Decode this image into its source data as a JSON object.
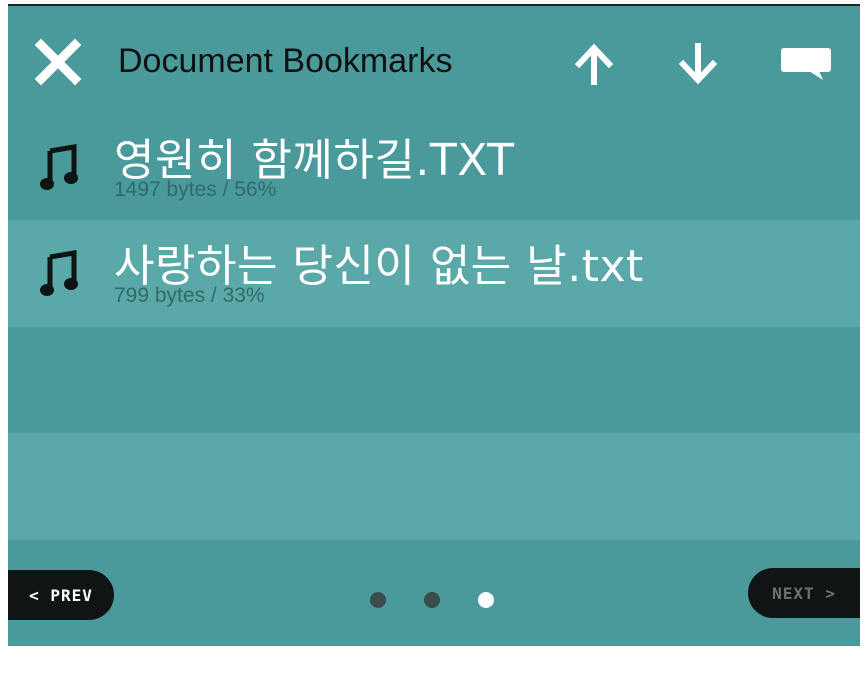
{
  "header": {
    "title": "Document Bookmarks",
    "icons": [
      "close-icon",
      "arrow-up-icon",
      "arrow-down-icon",
      "speech-bubble-icon"
    ]
  },
  "bookmarks": [
    {
      "icon": "music-note-icon",
      "name": "영원히 함께하길.TXT",
      "meta": "1497 bytes / 56%"
    },
    {
      "icon": "music-note-icon",
      "name": "사랑하는 당신이 없는 날.txt",
      "meta": "799 bytes / 33%"
    }
  ],
  "footer": {
    "prev_label": "< PREV",
    "next_label": "NEXT >",
    "pages": 3,
    "current_page": 3
  },
  "colors": {
    "background": "#4a9a9b",
    "row_light": "#5ba8a9",
    "button_bg": "#101414"
  }
}
